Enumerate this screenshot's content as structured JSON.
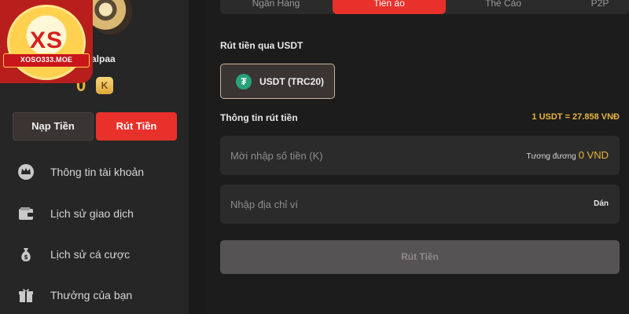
{
  "brand": {
    "logo_mark": "XS",
    "logo_text": "XOSO333.MOE"
  },
  "user": {
    "name": "alpaa",
    "balance": "0",
    "coin_symbol": "K"
  },
  "actions": {
    "deposit_label": "Nạp Tiền",
    "withdraw_label": "Rút Tiền"
  },
  "sidebar": {
    "items": [
      {
        "label": "Thông tin tài khoản",
        "icon": "crown-icon"
      },
      {
        "label": "Lịch sử giao dịch",
        "icon": "wallet-icon"
      },
      {
        "label": "Lịch sử cá cược",
        "icon": "money-bag-icon"
      },
      {
        "label": "Thưởng của bạn",
        "icon": "gift-icon"
      }
    ]
  },
  "tabs": [
    {
      "label": "Ngân Hàng",
      "active": false
    },
    {
      "label": "Tiền ảo",
      "active": true
    },
    {
      "label": "Thẻ Cào",
      "active": false
    },
    {
      "label": "P2P",
      "active": false
    }
  ],
  "withdraw": {
    "method_title": "Rút tiền qua USDT",
    "method_label": "USDT (TRC20)",
    "info_title": "Thông tin rút tiền",
    "rate": "1 USDT = 27.858 VNĐ",
    "amount_placeholder": "Mời nhập số tiền (K)",
    "equiv_label": "Tương đương",
    "equiv_value": "0 VND",
    "address_placeholder": "Nhập địa chỉ ví",
    "paste_label": "Dán",
    "submit_label": "Rút Tiền"
  },
  "colors": {
    "accent": "#e8312a",
    "gold": "#e8b53a",
    "tether": "#26a17b"
  }
}
